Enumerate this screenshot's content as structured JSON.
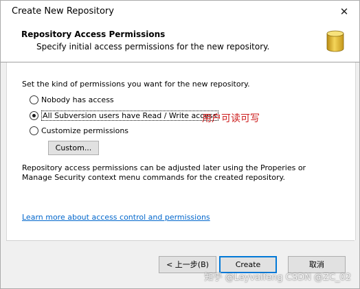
{
  "window": {
    "title": "Create New Repository",
    "close_glyph": "✕"
  },
  "header": {
    "title": "Repository Access Permissions",
    "subtitle": "Specify initial access permissions for the new repository.",
    "icon": "database-icon"
  },
  "content": {
    "instruction": "Set the kind of permissions you want for the new repository.",
    "options": [
      {
        "label": "Nobody has access",
        "selected": false
      },
      {
        "label": "All Subversion users have Read / Write access",
        "selected": true
      },
      {
        "label": "Customize permissions",
        "selected": false
      }
    ],
    "custom_button": "Custom...",
    "annotation": "用户可读可写",
    "info": "Repository access permissions can be adjusted later using the Properies or Manage Security context menu commands for the created repository.",
    "learn_link": "Learn more about access control and permissions"
  },
  "footer": {
    "back_button": "< 上一步(B)",
    "create_button": "Create",
    "cancel_button": "取消"
  },
  "watermark": "知乎 @Leyvalfeng  CSDN @ZC_02",
  "colors": {
    "annotation": "#cc1a1a",
    "link": "#0066cc",
    "primary_border": "#0078d7",
    "database_icon": "#e8c23a"
  }
}
